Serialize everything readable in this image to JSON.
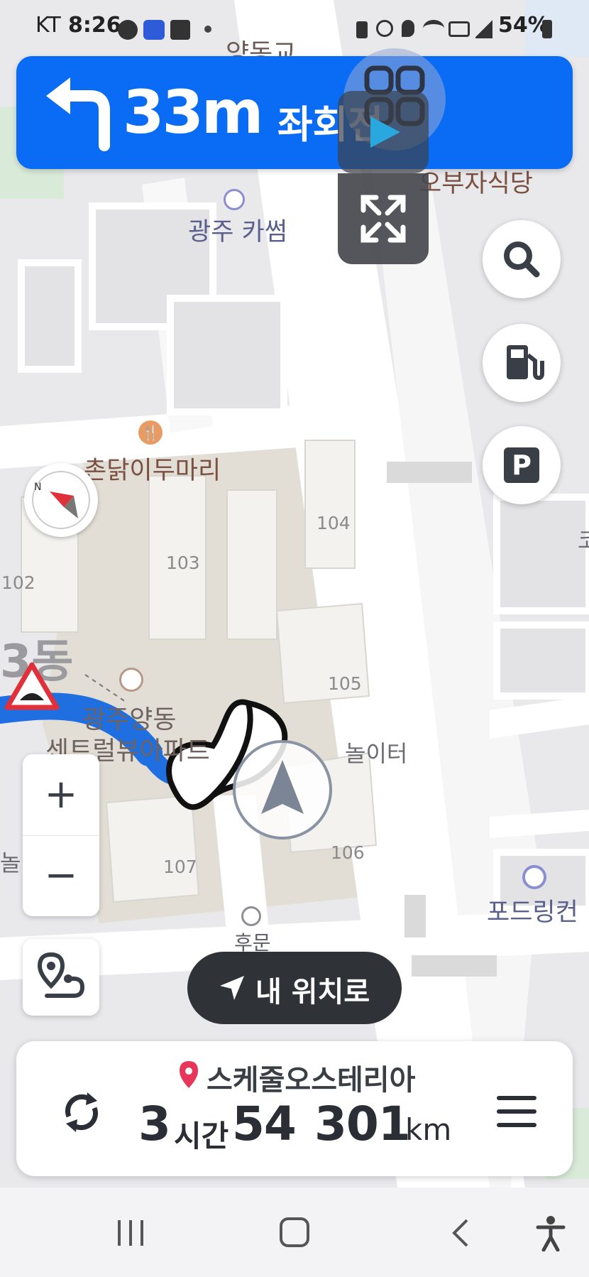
{
  "status_bar": {
    "carrier": "KT",
    "time": "8:26",
    "battery": "54%",
    "icons": [
      "car-icon",
      "app-badge-icon",
      "gallery-icon",
      "dot-icon",
      "battery-saver-icon",
      "alarm-icon",
      "location-icon",
      "wifi-icon",
      "hd-icon",
      "signal-icon",
      "battery-icon"
    ]
  },
  "navigation": {
    "turn_icon": "turn-left-arrow-icon",
    "distance": "33m",
    "direction": "좌회전",
    "road_label": "양동교"
  },
  "map_labels": {
    "poi_1": "광주 카썸",
    "poi_2": "오부자식당",
    "poi_3": "촌닭이두마리",
    "poi_4_line1": "광주양동",
    "poi_4_line2": "센트럴뷰아파트",
    "poi_5": "놀이터",
    "poi_6": "포드링컨",
    "poi_7": "후문",
    "district": "3동",
    "partial_left": "놀",
    "partial_right": "코",
    "buildings": [
      "102",
      "103",
      "104",
      "105",
      "106",
      "107"
    ]
  },
  "controls": {
    "search": "search-icon",
    "fuel": "gas-station-icon",
    "parking": "P",
    "zoom_in": "+",
    "zoom_out": "−",
    "my_location_button": "내 위치로"
  },
  "route_info": {
    "destination": "스케줄오스테리아",
    "hours": "3",
    "hours_unit": "시간",
    "minutes": "54",
    "distance": "301",
    "distance_unit": "km"
  },
  "colors": {
    "accent": "#0a6cf5",
    "route": "#1f6fe0",
    "dark_button": "#2f3338",
    "destination_pin": "#e8365a"
  }
}
